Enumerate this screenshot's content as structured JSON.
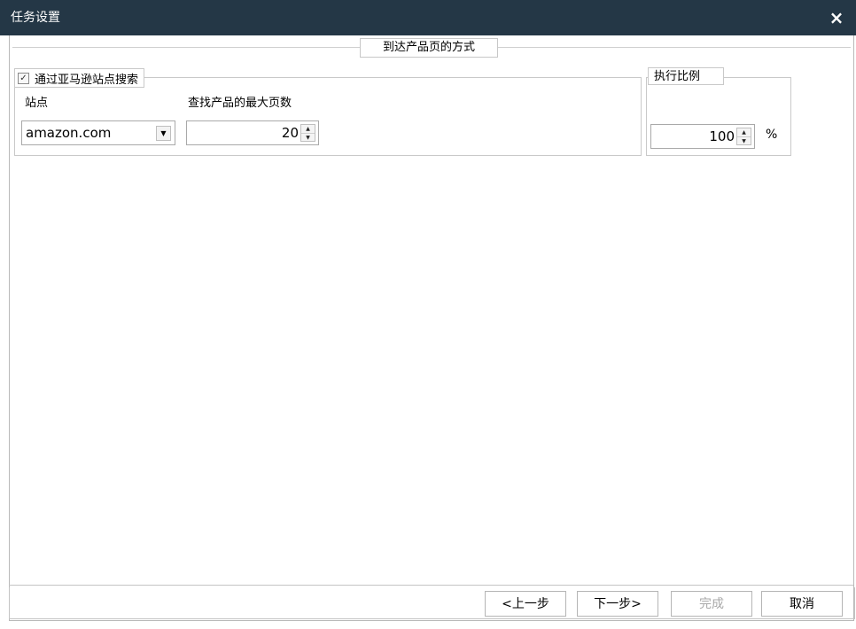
{
  "window": {
    "title": "任务设置",
    "close_glyph": "×"
  },
  "section": {
    "title": "到达产品页的方式"
  },
  "search_group": {
    "checkbox_label": "通过亚马逊站点搜索",
    "checkbox_checked": true,
    "check_glyph": "✓",
    "site_label": "站点",
    "site_value": "amazon.com",
    "dropdown_glyph": "▼",
    "max_pages_label": "查找产品的最大页数",
    "max_pages_value": "20"
  },
  "ratio_group": {
    "label": "执行比例",
    "value": "100",
    "unit": "%"
  },
  "spin_glyphs": {
    "up": "▲",
    "down": "▼"
  },
  "footer": {
    "prev_label": "<上一步",
    "next_label": "下一步>",
    "finish_label": "完成",
    "cancel_label": "取消"
  },
  "colors": {
    "titlebar": "#243746",
    "border": "#c9c9c9",
    "disabled_text": "#a8a8a8"
  }
}
